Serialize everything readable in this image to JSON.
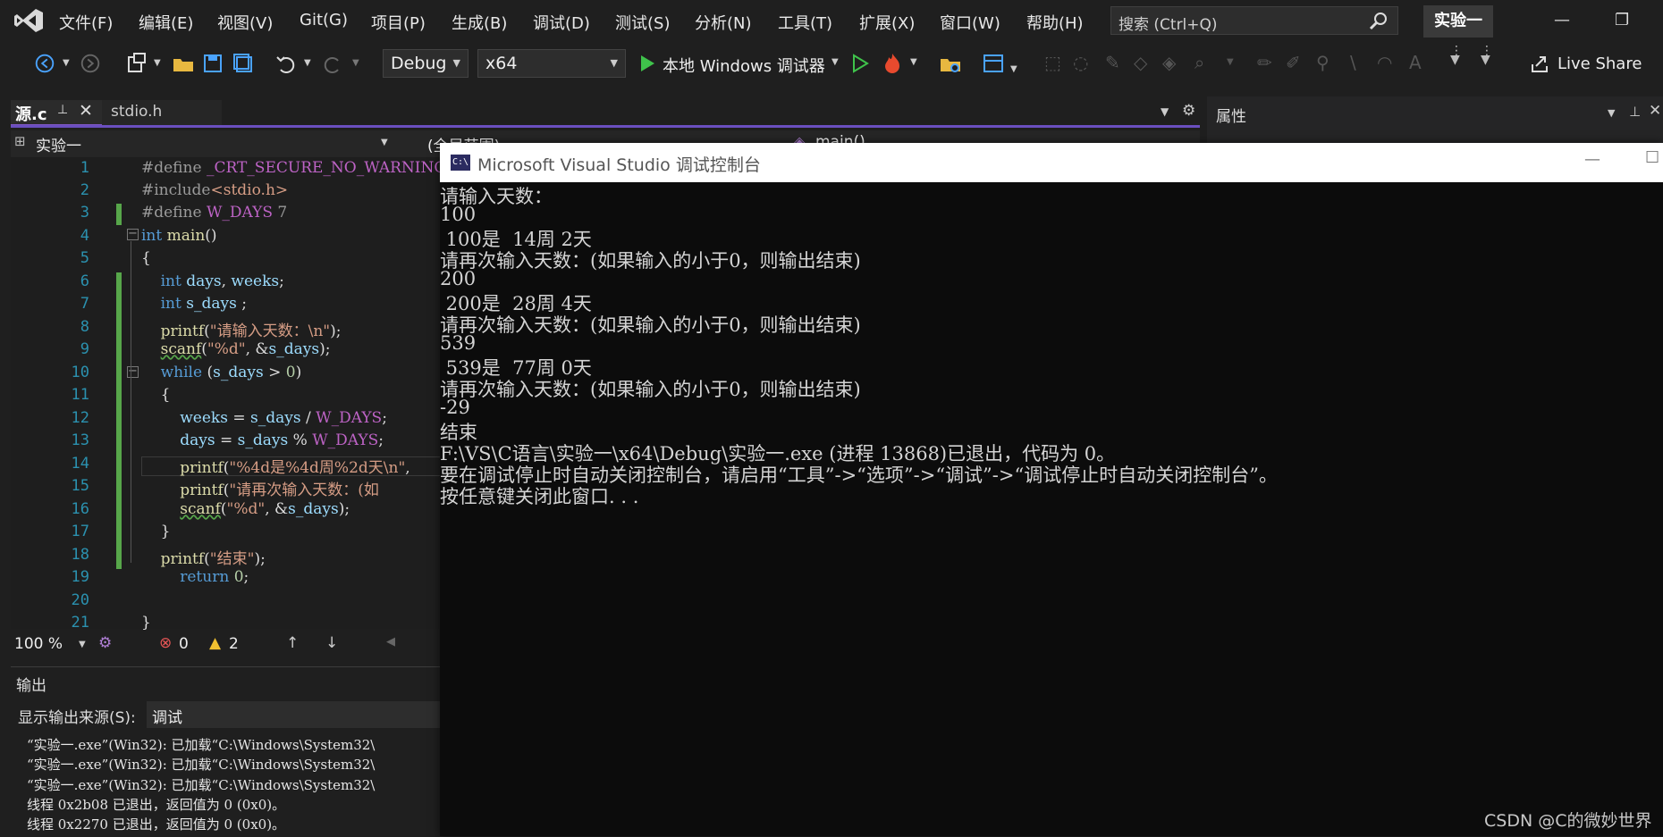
{
  "menubar": {
    "items": [
      "文件(F)",
      "编辑(E)",
      "视图(V)",
      "Git(G)",
      "项目(P)",
      "生成(B)",
      "调试(D)",
      "测试(S)",
      "分析(N)",
      "工具(T)",
      "扩展(X)",
      "窗口(W)",
      "帮助(H)"
    ],
    "search_placeholder": "搜索 (Ctrl+Q)",
    "solution_name": "实验一"
  },
  "toolbar": {
    "config": "Debug",
    "platform": "x64",
    "debugger": "本地 Windows 调试器",
    "live_share": "Live Share"
  },
  "tabs": {
    "active": "源.c",
    "other": "stdio.h",
    "properties": "属性"
  },
  "nav": {
    "project": "实验一",
    "scope": "(全局范围)",
    "member": "main()"
  },
  "editor": {
    "line_numbers": [
      "1",
      "2",
      "3",
      "4",
      "5",
      "6",
      "7",
      "8",
      "9",
      "10",
      "11",
      "12",
      "13",
      "14",
      "15",
      "16",
      "17",
      "18",
      "19",
      "20",
      "21"
    ],
    "zoom": "100 %",
    "errors": "0",
    "warnings": "2"
  },
  "output": {
    "title": "输出",
    "source_label": "显示输出来源(S):",
    "source_value": "调试",
    "lines": [
      "“实验一.exe”(Win32): 已加载“C:\\Windows\\System32\\",
      "“实验一.exe”(Win32): 已加载“C:\\Windows\\System32\\",
      "“实验一.exe”(Win32): 已加载“C:\\Windows\\System32\\",
      "线程 0x2b08 已退出，返回值为 0 (0x0)。",
      "线程 0x2270 已退出，返回值为 0 (0x0)。"
    ]
  },
  "console": {
    "title": "Microsoft Visual Studio 调试控制台",
    "icon_text": "C:\\",
    "lines": [
      "请输入天数：",
      "100",
      " 100是  14周 2天",
      "请再次输入天数：(如果输入的小于0，则输出结束)",
      "200",
      " 200是  28周 4天",
      "请再次输入天数：(如果输入的小于0，则输出结束)",
      "539",
      " 539是  77周 0天",
      "请再次输入天数：(如果输入的小于0，则输出结束)",
      "-29",
      "结束",
      "F:\\VS\\C语言\\实验一\\x64\\Debug\\实验一.exe (进程 13868)已退出，代码为 0。",
      "要在调试停止时自动关闭控制台，请启用“工具”->“选项”->“调试”->“调试停止时自动关闭控制台”。",
      "按任意键关闭此窗口. . ."
    ]
  },
  "watermark": "CSDN @C的微妙世界",
  "colors": {
    "accent": "#7e57c2",
    "keyword": "#569cd6",
    "string": "#d69d85",
    "macro": "#bd63c5",
    "green_change": "#57a64a"
  }
}
